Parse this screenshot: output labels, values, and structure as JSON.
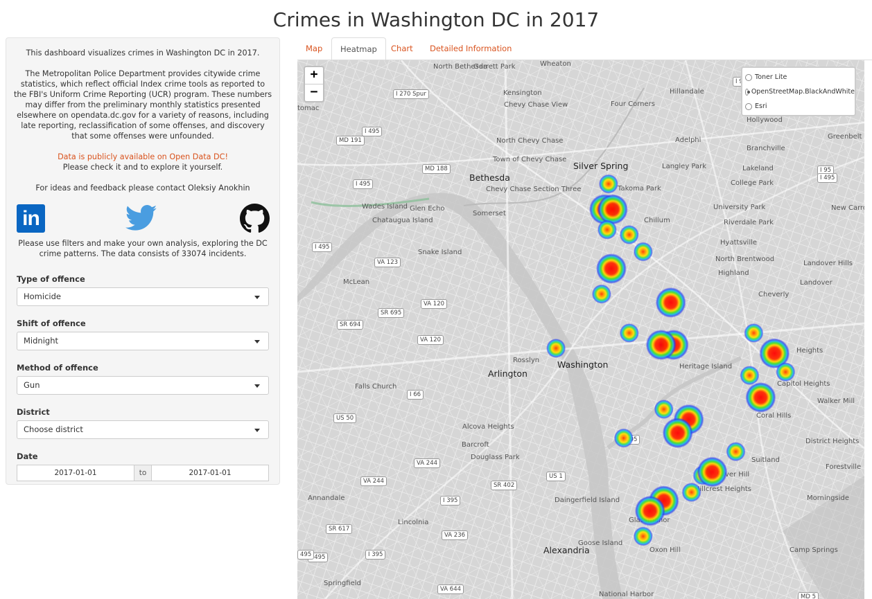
{
  "page": {
    "title": "Crimes in Washington DC in 2017"
  },
  "sidebar": {
    "intro": "This dashboard visualizes crimes in Washington DC in 2017.",
    "description": "The Metropolitan Police Department provides citywide crime statistics, which reflect official Index crime tools as reported to the FBI's Uniform Crime Reporting (UCR) program. These numbers may differ from the preliminary monthly statistics presented elsewhere on opendata.dc.gov for a variety of reasons, including late reporting, reclassification of some offenses, and discovery that some offenses were unfounded.",
    "data_link": "Data is publicly available on Open Data DC!",
    "data_check": "Please check it and to explore it yourself.",
    "contact": "For ideas and feedback please contact Oleksiy Anokhin",
    "linkedin_text": "in",
    "analysis": "Please use filters and make your own analysis, exploring the DC crime patterns. The data consists of 33074 incidents.",
    "filters": [
      {
        "label": "Type of offence",
        "value": "Homicide"
      },
      {
        "label": "Shift of offence",
        "value": "Midnight"
      },
      {
        "label": "Method of offence",
        "value": "Gun"
      },
      {
        "label": "District",
        "value": "Choose district"
      }
    ],
    "date": {
      "label": "Date",
      "from": "2017-01-01",
      "sep": "to",
      "to": "2017-01-01"
    }
  },
  "tabs": [
    {
      "label": "Map",
      "active": false
    },
    {
      "label": "Heatmap",
      "active": true
    },
    {
      "label": "Chart",
      "active": false
    },
    {
      "label": "Detailed Information",
      "active": false
    }
  ],
  "map": {
    "zoom_in": "+",
    "zoom_out": "−",
    "layers": [
      {
        "label": "Toner Lite",
        "selected": false
      },
      {
        "label": "OpenStreetMap.BlackAndWhite",
        "selected": true
      },
      {
        "label": "Esri",
        "selected": false
      }
    ],
    "places": [
      {
        "name": "Silver Spring",
        "cls": "city"
      },
      {
        "name": "Bethesda",
        "cls": "city"
      },
      {
        "name": "Washington",
        "cls": "city"
      },
      {
        "name": "Arlington",
        "cls": "city"
      },
      {
        "name": "Alexandria",
        "cls": "city"
      },
      {
        "name": "Takoma Park",
        "cls": ""
      },
      {
        "name": "Chillum",
        "cls": ""
      },
      {
        "name": "Hyattsville",
        "cls": ""
      },
      {
        "name": "North Brentwood",
        "cls": ""
      },
      {
        "name": "Highland",
        "cls": ""
      },
      {
        "name": "Cheverly",
        "cls": ""
      },
      {
        "name": "Landover",
        "cls": ""
      },
      {
        "name": "Landover Hills",
        "cls": ""
      },
      {
        "name": "Riverdale Park",
        "cls": ""
      },
      {
        "name": "University Park",
        "cls": ""
      },
      {
        "name": "College Park",
        "cls": ""
      },
      {
        "name": "Lakeland",
        "cls": ""
      },
      {
        "name": "Langley Park",
        "cls": ""
      },
      {
        "name": "Adelphi",
        "cls": ""
      },
      {
        "name": "Hillandale",
        "cls": ""
      },
      {
        "name": "Four Corners",
        "cls": ""
      },
      {
        "name": "Branchville",
        "cls": ""
      },
      {
        "name": "Greenbelt",
        "cls": ""
      },
      {
        "name": "New Carrollton",
        "cls": ""
      },
      {
        "name": "Hollywood",
        "cls": ""
      },
      {
        "name": "Wheaton",
        "cls": ""
      },
      {
        "name": "Kensington",
        "cls": ""
      },
      {
        "name": "Chevy Chase View",
        "cls": ""
      },
      {
        "name": "North Chevy Chase",
        "cls": ""
      },
      {
        "name": "Town of Chevy Chase",
        "cls": ""
      },
      {
        "name": "Chevy Chase Section Three",
        "cls": ""
      },
      {
        "name": "Garrett Park",
        "cls": ""
      },
      {
        "name": "North Bethesda",
        "cls": ""
      },
      {
        "name": "Somerset",
        "cls": ""
      },
      {
        "name": "Glen Echo",
        "cls": ""
      },
      {
        "name": "Wades Island",
        "cls": ""
      },
      {
        "name": "Chataugua Island",
        "cls": ""
      },
      {
        "name": "Snake Island",
        "cls": ""
      },
      {
        "name": "McLean",
        "cls": ""
      },
      {
        "name": "Rosslyn",
        "cls": ""
      },
      {
        "name": "Falls Church",
        "cls": ""
      },
      {
        "name": "Alcova Heights",
        "cls": ""
      },
      {
        "name": "Barcroft",
        "cls": ""
      },
      {
        "name": "Douglass Park",
        "cls": ""
      },
      {
        "name": "Annandale",
        "cls": ""
      },
      {
        "name": "Lincolnia",
        "cls": ""
      },
      {
        "name": "Springfield",
        "cls": ""
      },
      {
        "name": "Heritage Island",
        "cls": ""
      },
      {
        "name": "Capitol Heights",
        "cls": ""
      },
      {
        "name": "Coral Hills",
        "cls": ""
      },
      {
        "name": "Walker Mill",
        "cls": ""
      },
      {
        "name": "District Heights",
        "cls": ""
      },
      {
        "name": "Suitland",
        "cls": ""
      },
      {
        "name": "Forestville",
        "cls": ""
      },
      {
        "name": "Morningside",
        "cls": ""
      },
      {
        "name": "Silver Hill",
        "cls": ""
      },
      {
        "name": "Hillcrest Heights",
        "cls": ""
      },
      {
        "name": "Glassmanor",
        "cls": ""
      },
      {
        "name": "Oxon Hill",
        "cls": ""
      },
      {
        "name": "Camp Springs",
        "cls": ""
      },
      {
        "name": "Goose Island",
        "cls": ""
      },
      {
        "name": "Daingerfield Island",
        "cls": ""
      },
      {
        "name": "National Harbor",
        "cls": ""
      },
      {
        "name": "Heights",
        "cls": ""
      },
      {
        "name": "tomac",
        "cls": ""
      }
    ],
    "shields": [
      "I 270 Spur",
      "I 495",
      "MD 191",
      "MD 188",
      "I 495",
      "I 495",
      "VA 123",
      "VA 120",
      "SR 695",
      "SR 694",
      "VA 120",
      "I 66",
      "US 50",
      "I 495",
      "I 95",
      "I 95",
      "I 495",
      "I 295",
      "US 1",
      "SR 402",
      "VA 244",
      "VA 244",
      "I 395",
      "SR 617",
      "VA 236",
      "I 395",
      "VA 644",
      "MD 5",
      "495"
    ],
    "hotspots": [
      {
        "lat": 38.99,
        "lon": -77.03,
        "intensity": 0.6
      },
      {
        "lat": 38.975,
        "lon": -77.033,
        "intensity": 0.8
      },
      {
        "lat": 38.975,
        "lon": -77.027,
        "intensity": 0.8
      },
      {
        "lat": 38.963,
        "lon": -77.031,
        "intensity": 0.6
      },
      {
        "lat": 38.96,
        "lon": -77.015,
        "intensity": 0.5
      },
      {
        "lat": 38.95,
        "lon": -77.005,
        "intensity": 0.5
      },
      {
        "lat": 38.94,
        "lon": -77.028,
        "intensity": 1.0
      },
      {
        "lat": 38.925,
        "lon": -77.035,
        "intensity": 0.5
      },
      {
        "lat": 38.92,
        "lon": -76.985,
        "intensity": 0.9
      },
      {
        "lat": 38.902,
        "lon": -77.015,
        "intensity": 0.5
      },
      {
        "lat": 38.893,
        "lon": -77.068,
        "intensity": 0.5
      },
      {
        "lat": 38.895,
        "lon": -76.983,
        "intensity": 1.0
      },
      {
        "lat": 38.895,
        "lon": -76.992,
        "intensity": 0.9
      },
      {
        "lat": 38.902,
        "lon": -76.925,
        "intensity": 0.5
      },
      {
        "lat": 38.89,
        "lon": -76.91,
        "intensity": 1.0
      },
      {
        "lat": 38.879,
        "lon": -76.902,
        "intensity": 0.5
      },
      {
        "lat": 38.877,
        "lon": -76.928,
        "intensity": 0.5
      },
      {
        "lat": 38.864,
        "lon": -76.92,
        "intensity": 0.9
      },
      {
        "lat": 38.857,
        "lon": -76.99,
        "intensity": 0.5
      },
      {
        "lat": 38.851,
        "lon": -76.972,
        "intensity": 1.0
      },
      {
        "lat": 38.843,
        "lon": -76.98,
        "intensity": 1.0
      },
      {
        "lat": 38.84,
        "lon": -77.019,
        "intensity": 0.5
      },
      {
        "lat": 38.832,
        "lon": -76.938,
        "intensity": 0.5
      },
      {
        "lat": 38.818,
        "lon": -76.962,
        "intensity": 0.5
      },
      {
        "lat": 38.82,
        "lon": -76.955,
        "intensity": 1.0
      },
      {
        "lat": 38.808,
        "lon": -76.97,
        "intensity": 0.5
      },
      {
        "lat": 38.803,
        "lon": -76.99,
        "intensity": 1.0
      },
      {
        "lat": 38.797,
        "lon": -77.0,
        "intensity": 1.0
      },
      {
        "lat": 38.782,
        "lon": -77.005,
        "intensity": 0.5
      }
    ]
  }
}
